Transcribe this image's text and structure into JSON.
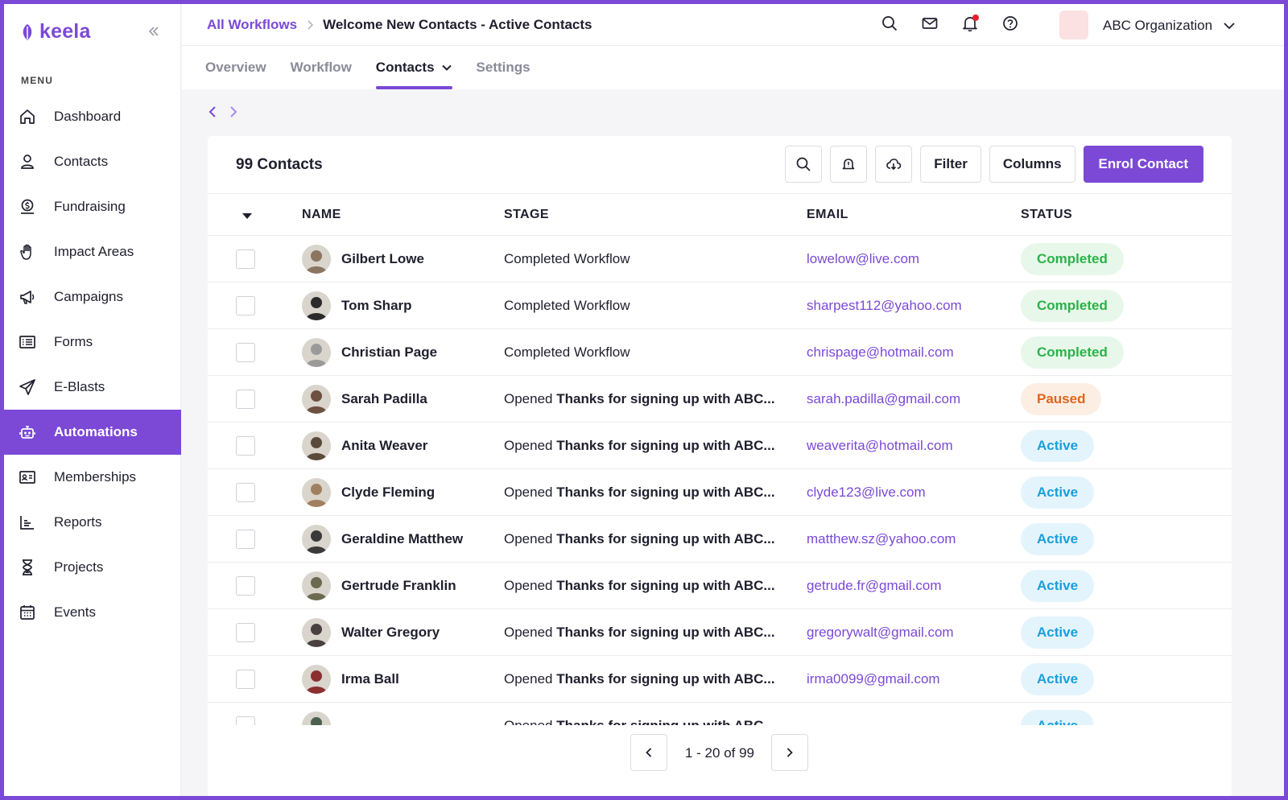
{
  "app": {
    "logo": "keela",
    "brand_color": "#7b49d6"
  },
  "sidebar": {
    "menu_label": "MENU",
    "items": [
      {
        "label": "Dashboard",
        "icon": "home-icon"
      },
      {
        "label": "Contacts",
        "icon": "user-icon"
      },
      {
        "label": "Fundraising",
        "icon": "coin-icon"
      },
      {
        "label": "Impact Areas",
        "icon": "hand-icon"
      },
      {
        "label": "Campaigns",
        "icon": "megaphone-icon"
      },
      {
        "label": "Forms",
        "icon": "form-icon"
      },
      {
        "label": "E-Blasts",
        "icon": "send-icon"
      },
      {
        "label": "Automations",
        "icon": "robot-icon",
        "active": true
      },
      {
        "label": "Memberships",
        "icon": "id-card-icon"
      },
      {
        "label": "Reports",
        "icon": "chart-icon"
      },
      {
        "label": "Projects",
        "icon": "hourglass-icon"
      },
      {
        "label": "Events",
        "icon": "calendar-icon"
      }
    ]
  },
  "header": {
    "breadcrumb_root": "All Workflows",
    "breadcrumb_current": "Welcome New Contacts - Active Contacts",
    "org_name": "ABC Organization"
  },
  "tabs": [
    {
      "label": "Overview"
    },
    {
      "label": "Workflow"
    },
    {
      "label": "Contacts",
      "active": true
    },
    {
      "label": "Settings"
    }
  ],
  "table": {
    "count_label": "99 Contacts",
    "actions": {
      "filter": "Filter",
      "columns": "Columns",
      "enrol": "Enrol Contact"
    },
    "columns": {
      "name": "NAME",
      "stage": "STAGE",
      "email": "EMAIL",
      "status": "STATUS"
    },
    "rows": [
      {
        "name": "Gilbert Lowe",
        "stage_prefix": "Completed Workflow",
        "stage_bold": "",
        "email": "lowelow@live.com",
        "status": "Completed"
      },
      {
        "name": "Tom Sharp",
        "stage_prefix": "Completed Workflow",
        "stage_bold": "",
        "email": "sharpest112@yahoo.com",
        "status": "Completed"
      },
      {
        "name": "Christian Page",
        "stage_prefix": "Completed Workflow",
        "stage_bold": "",
        "email": "chrispage@hotmail.com",
        "status": "Completed"
      },
      {
        "name": "Sarah Padilla",
        "stage_prefix": "Opened ",
        "stage_bold": "Thanks for signing up with ABC...",
        "email": "sarah.padilla@gmail.com",
        "status": "Paused"
      },
      {
        "name": "Anita Weaver",
        "stage_prefix": "Opened ",
        "stage_bold": "Thanks for signing up with ABC...",
        "email": "weaverita@hotmail.com",
        "status": "Active"
      },
      {
        "name": "Clyde Fleming",
        "stage_prefix": "Opened ",
        "stage_bold": "Thanks for signing up with ABC...",
        "email": "clyde123@live.com",
        "status": "Active"
      },
      {
        "name": "Geraldine Matthew",
        "stage_prefix": "Opened ",
        "stage_bold": "Thanks for signing up with ABC...",
        "email": "matthew.sz@yahoo.com",
        "status": "Active"
      },
      {
        "name": "Gertrude Franklin",
        "stage_prefix": "Opened ",
        "stage_bold": "Thanks for signing up with ABC...",
        "email": "getrude.fr@gmail.com",
        "status": "Active"
      },
      {
        "name": "Walter Gregory",
        "stage_prefix": "Opened ",
        "stage_bold": "Thanks for signing up with ABC...",
        "email": "gregorywalt@gmail.com",
        "status": "Active"
      },
      {
        "name": "Irma Ball",
        "stage_prefix": "Opened ",
        "stage_bold": "Thanks for signing up with ABC...",
        "email": "irma0099@gmail.com",
        "status": "Active"
      },
      {
        "name": "",
        "stage_prefix": "Opened ",
        "stage_bold": "Thanks for signing up with ABC...",
        "email": "",
        "status": "Active"
      }
    ]
  },
  "pagination": {
    "range": "1 - 20 of 99"
  },
  "status_colors": {
    "Completed": "#2cb14a",
    "Paused": "#e0651c",
    "Active": "#1a9fdc"
  }
}
